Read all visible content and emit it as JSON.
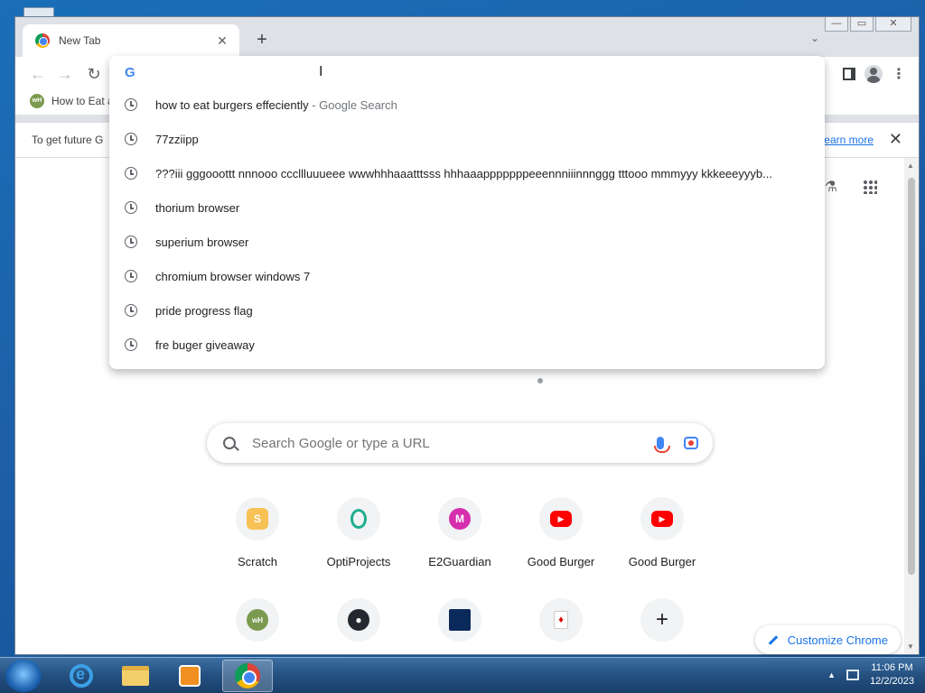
{
  "tab": {
    "title": "New Tab",
    "close": "✕"
  },
  "toolbar": {
    "back": "←",
    "forward": "→",
    "reload": "↻",
    "menu": "⋮",
    "new_tab": "+",
    "tab_search": "⌄"
  },
  "window_controls": {
    "minimize": "—",
    "maximize": "▭",
    "close": "✕"
  },
  "bookmarks": {
    "items": [
      {
        "label": "How to Eat a",
        "favicon_text": "wH"
      }
    ]
  },
  "infobar": {
    "text": "To get future G",
    "link": "earn more",
    "close": "✕"
  },
  "omnibox": {
    "logo": "G",
    "cursor": "I",
    "suggestions": [
      {
        "text": "how to eat burgers effeciently",
        "sub": " - Google Search"
      },
      {
        "text": "77zziipp",
        "sub": ""
      },
      {
        "text": "???iii gggooottt nnnooo cccllluuueee wwwhhhaaatttsss hhhaaapppppppeeennniiinnnggg tttooo mmmyyy kkkeeeyyyb...",
        "sub": ""
      },
      {
        "text": "thorium browser",
        "sub": ""
      },
      {
        "text": "superium browser",
        "sub": ""
      },
      {
        "text": "chromium browser windows 7",
        "sub": ""
      },
      {
        "text": "pride progress flag",
        "sub": ""
      },
      {
        "text": "fre buger giveaway",
        "sub": ""
      }
    ]
  },
  "ntp": {
    "search_placeholder": "Search Google or type a URL",
    "customize_label": "Customize Chrome",
    "shortcuts": [
      {
        "label": "Scratch",
        "icon": "scratch-icon",
        "glyph": "S"
      },
      {
        "label": "OptiProjects",
        "icon": "optiprojects-icon",
        "glyph": "O"
      },
      {
        "label": "E2Guardian",
        "icon": "e2guardian-icon",
        "glyph": "M"
      },
      {
        "label": "Good Burger",
        "icon": "youtube-icon",
        "glyph": "▶"
      },
      {
        "label": "Good Burger",
        "icon": "youtube-icon",
        "glyph": "▶"
      }
    ],
    "shortcuts_row2": [
      {
        "icon": "wikihow-icon",
        "glyph": "wH"
      },
      {
        "icon": "github-icon",
        "glyph": "●"
      },
      {
        "icon": "blue-site-icon",
        "glyph": ""
      },
      {
        "icon": "card-game-icon",
        "glyph": "♦"
      },
      {
        "icon": "add-shortcut-icon",
        "glyph": "+"
      }
    ]
  },
  "taskbar": {
    "time": "11:06 PM",
    "date": "12/2/2023",
    "tray_arrow": "▲"
  },
  "colors": {
    "accent": "#1a73e8",
    "tab_strip": "#dee1e6",
    "taskbar": "#24507f"
  }
}
